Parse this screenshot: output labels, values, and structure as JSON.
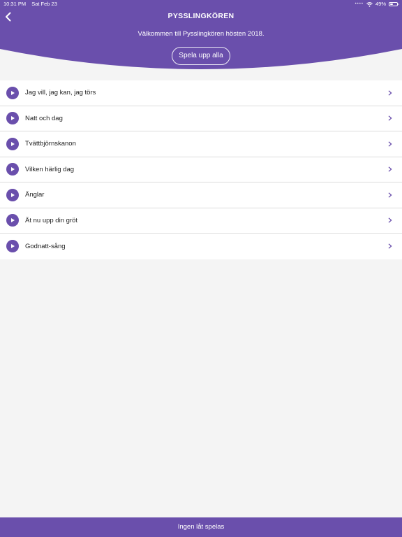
{
  "status_bar": {
    "time": "10:31 PM",
    "date": "Sat Feb 23",
    "battery_text": "49%",
    "battery_level": 0.49
  },
  "header": {
    "title": "PYSSLINGKÖREN",
    "welcome": "Välkommen till Pysslingkören hösten 2018.",
    "play_all_label": "Spela upp alla"
  },
  "songs": [
    "Jag vill, jag kan, jag törs",
    "Natt och dag",
    "Tvättbjörnskanon",
    "Vilken härlig dag",
    "Änglar",
    "Ät nu upp din gröt",
    "Godnatt-sång"
  ],
  "footer": {
    "now_playing": "Ingen låt spelas"
  },
  "colors": {
    "brand": "#6a4fac",
    "background": "#f4f4f4"
  }
}
